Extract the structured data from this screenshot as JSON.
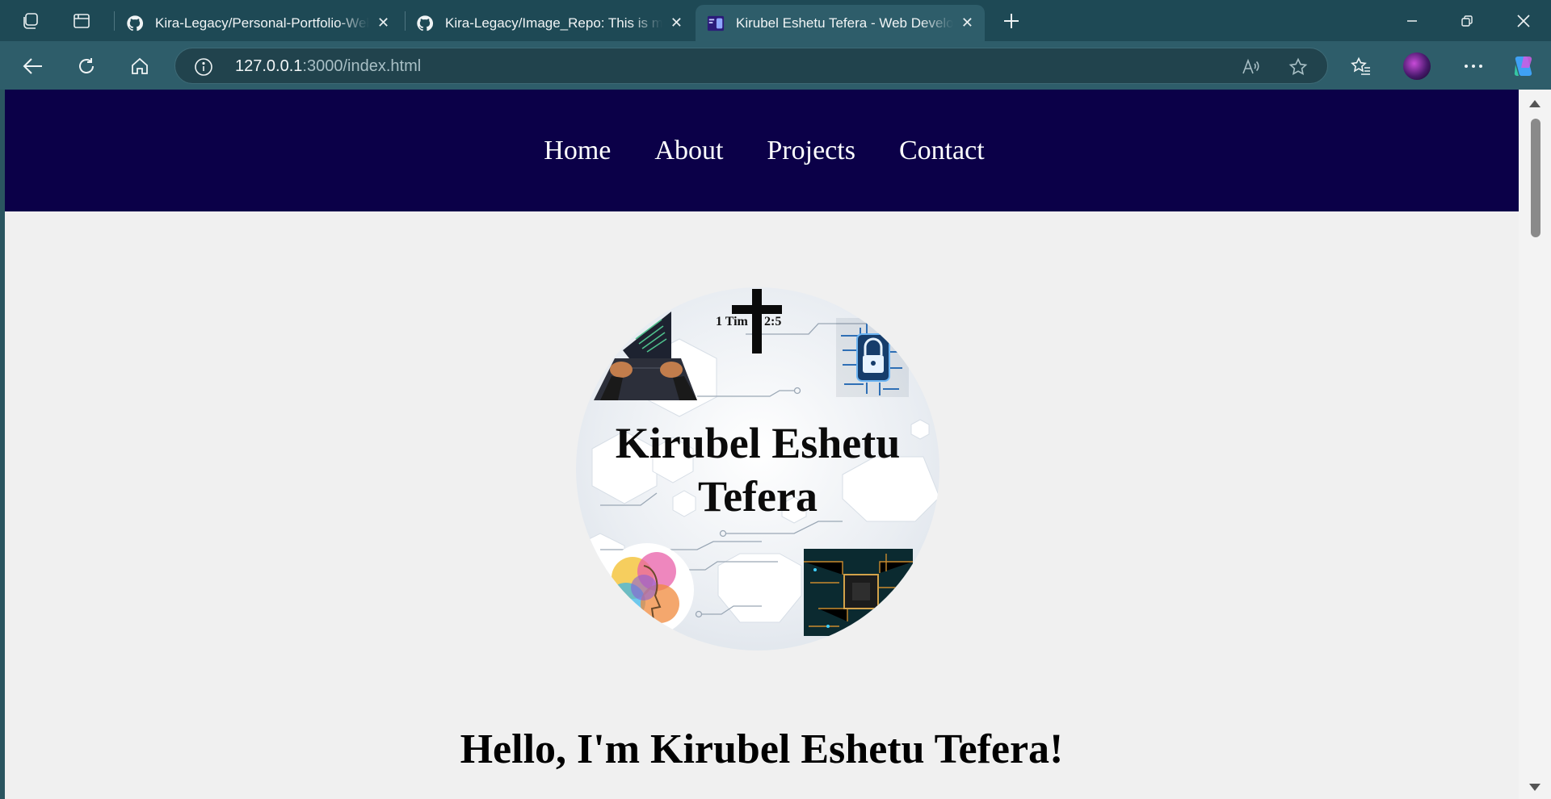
{
  "browser": {
    "tabs": [
      {
        "title": "Kira-Legacy/Personal-Portfolio-Website",
        "favicon": "github-icon",
        "active": false
      },
      {
        "title": "Kira-Legacy/Image_Repo: This is my image repo",
        "favicon": "github-icon",
        "active": false
      },
      {
        "title": "Kirubel Eshetu Tefera - Web Developer",
        "favicon": "site-icon",
        "active": true
      }
    ],
    "url_host": "127.0.0.1",
    "url_rest": ":3000/index.html"
  },
  "site": {
    "nav": [
      "Home",
      "About",
      "Projects",
      "Contact"
    ],
    "hero_name_line1": "Kirubel Eshetu",
    "hero_name_line2": "Tefera",
    "verse_left": "1 Tim",
    "verse_right": "2:5",
    "greeting": "Hello, I'm Kirubel Eshetu Tefera!"
  },
  "colors": {
    "nav_bg": "#0b0048",
    "page_bg": "#f0f0f0",
    "chrome_dark": "#1e4955",
    "chrome_toolbar": "#2e5d6a"
  }
}
